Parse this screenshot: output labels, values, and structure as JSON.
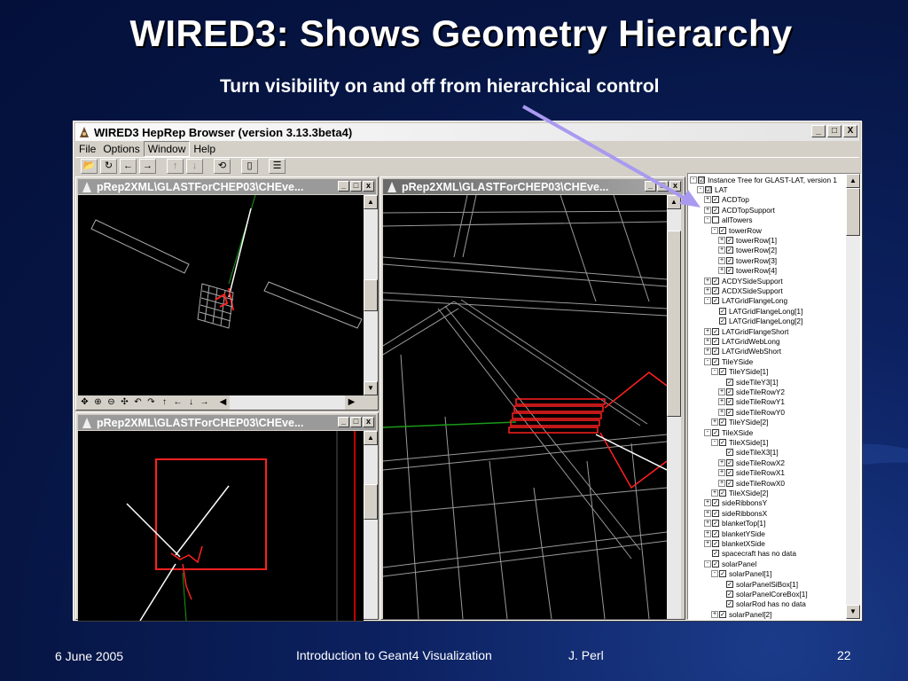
{
  "slide": {
    "title": "WIRED3: Shows Geometry Hierarchy",
    "subtitle": "Turn visibility on and off from hierarchical control"
  },
  "app": {
    "title": "WIRED3 HepRep Browser (version 3.13.3beta4)",
    "menus": [
      "File",
      "Options",
      "Window",
      "Help"
    ],
    "toolbar_icons": [
      "open-icon",
      "refresh-icon",
      "back-icon",
      "forward-icon",
      "up-icon",
      "down-icon",
      "spin-icon",
      "new-icon",
      "tree-icon"
    ],
    "window_buttons": {
      "minimize": "_",
      "maximize": "□",
      "close": "X"
    }
  },
  "views": [
    {
      "title": "pRep2XML\\GLASTForCHEP03\\CHEve...",
      "active": false
    },
    {
      "title": "pRep2XML\\GLASTForCHEP03\\CHEve...",
      "active": true
    },
    {
      "title": "pRep2XML\\GLASTForCHEP03\\CHEve...",
      "active": false
    }
  ],
  "nav_glyphs": [
    "✥",
    "⊕",
    "⊖",
    "✣",
    "↶",
    "↷",
    "↑",
    "←",
    "↓",
    "→",
    "◀",
    "▶"
  ],
  "tree": [
    {
      "label": "Instance Tree for GLAST-LAT, version 1",
      "depth": 0,
      "exp": "-",
      "check": "☑"
    },
    {
      "label": "LAT",
      "depth": 1,
      "exp": "-",
      "check": "☑"
    },
    {
      "label": "ACDTop",
      "depth": 2,
      "exp": "+",
      "check": "✓"
    },
    {
      "label": "ACDTopSupport",
      "depth": 2,
      "exp": "+",
      "check": "✓"
    },
    {
      "label": "allTowers",
      "depth": 2,
      "exp": "-",
      "check": ""
    },
    {
      "label": "towerRow",
      "depth": 3,
      "exp": "-",
      "check": "✓"
    },
    {
      "label": "towerRow[1]",
      "depth": 4,
      "exp": "+",
      "check": "✓"
    },
    {
      "label": "towerRow[2]",
      "depth": 4,
      "exp": "+",
      "check": "✓"
    },
    {
      "label": "towerRow[3]",
      "depth": 4,
      "exp": "+",
      "check": "✓"
    },
    {
      "label": "towerRow[4]",
      "depth": 4,
      "exp": "+",
      "check": "✓"
    },
    {
      "label": "ACDYSideSupport",
      "depth": 2,
      "exp": "+",
      "check": "✓"
    },
    {
      "label": "ACDXSideSupport",
      "depth": 2,
      "exp": "+",
      "check": "✓"
    },
    {
      "label": "LATGridFlangeLong",
      "depth": 2,
      "exp": "-",
      "check": "✓"
    },
    {
      "label": "LATGridFlangeLong[1]",
      "depth": 3,
      "exp": "",
      "check": "✓"
    },
    {
      "label": "LATGridFlangeLong[2]",
      "depth": 3,
      "exp": "",
      "check": "✓"
    },
    {
      "label": "LATGridFlangeShort",
      "depth": 2,
      "exp": "+",
      "check": "✓"
    },
    {
      "label": "LATGridWebLong",
      "depth": 2,
      "exp": "+",
      "check": "✓"
    },
    {
      "label": "LATGridWebShort",
      "depth": 2,
      "exp": "+",
      "check": "✓"
    },
    {
      "label": "TileYSide",
      "depth": 2,
      "exp": "-",
      "check": "✓"
    },
    {
      "label": "TileYSide[1]",
      "depth": 3,
      "exp": "-",
      "check": "✓"
    },
    {
      "label": "sideTileY3[1]",
      "depth": 4,
      "exp": "",
      "check": "✓"
    },
    {
      "label": "sideTileRowY2",
      "depth": 4,
      "exp": "+",
      "check": "✓"
    },
    {
      "label": "sideTileRowY1",
      "depth": 4,
      "exp": "+",
      "check": "✓"
    },
    {
      "label": "sideTileRowY0",
      "depth": 4,
      "exp": "+",
      "check": "✓"
    },
    {
      "label": "TileYSide[2]",
      "depth": 3,
      "exp": "+",
      "check": "✓"
    },
    {
      "label": "TileXSide",
      "depth": 2,
      "exp": "-",
      "check": "✓"
    },
    {
      "label": "TileXSide[1]",
      "depth": 3,
      "exp": "-",
      "check": "✓"
    },
    {
      "label": "sideTileX3[1]",
      "depth": 4,
      "exp": "",
      "check": "✓"
    },
    {
      "label": "sideTileRowX2",
      "depth": 4,
      "exp": "+",
      "check": "✓"
    },
    {
      "label": "sideTileRowX1",
      "depth": 4,
      "exp": "+",
      "check": "✓"
    },
    {
      "label": "sideTileRowX0",
      "depth": 4,
      "exp": "+",
      "check": "✓"
    },
    {
      "label": "TileXSide[2]",
      "depth": 3,
      "exp": "+",
      "check": "✓"
    },
    {
      "label": "sideRibbonsY",
      "depth": 2,
      "exp": "+",
      "check": "✓"
    },
    {
      "label": "sideRibbonsX",
      "depth": 2,
      "exp": "+",
      "check": "✓"
    },
    {
      "label": "blanketTop[1]",
      "depth": 2,
      "exp": "+",
      "check": "✓"
    },
    {
      "label": "blanketYSide",
      "depth": 2,
      "exp": "+",
      "check": "✓"
    },
    {
      "label": "blanketXSide",
      "depth": 2,
      "exp": "+",
      "check": "✓"
    },
    {
      "label": "spacecraft has no data",
      "depth": 2,
      "exp": "",
      "check": "✓"
    },
    {
      "label": "solarPanel",
      "depth": 2,
      "exp": "-",
      "check": "✓"
    },
    {
      "label": "solarPanel[1]",
      "depth": 3,
      "exp": "-",
      "check": "✓"
    },
    {
      "label": "solarPanelSiBox[1]",
      "depth": 4,
      "exp": "",
      "check": "✓"
    },
    {
      "label": "solarPanelCoreBox[1]",
      "depth": 4,
      "exp": "",
      "check": "✓"
    },
    {
      "label": "solarRod has no data",
      "depth": 4,
      "exp": "",
      "check": "✓"
    },
    {
      "label": "solarPanel[2]",
      "depth": 3,
      "exp": "+",
      "check": "✓"
    }
  ],
  "footer": {
    "date": "6 June 2005",
    "center": "Introduction to Geant4 Visualization",
    "author": "J. Perl",
    "page": "22"
  },
  "colors": {
    "accent_arrow": "#a99af0",
    "track_red": "#ff2020",
    "bg": "#061544"
  }
}
